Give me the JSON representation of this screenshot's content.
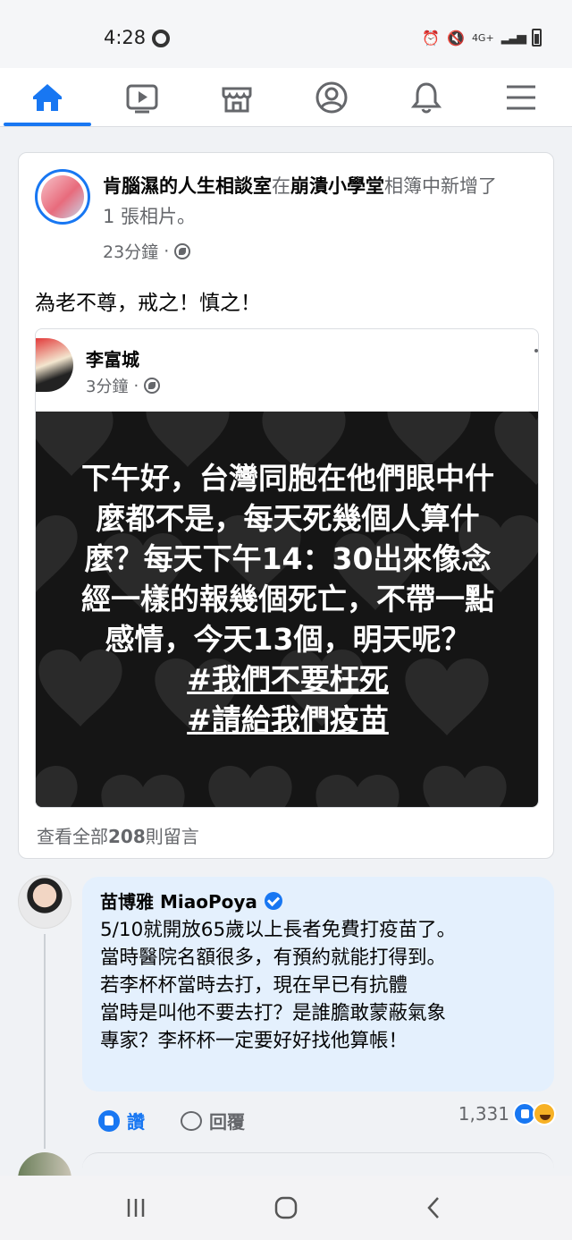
{
  "status_bar": {
    "time": "4:28",
    "network": "4G+",
    "icons": [
      "chrome-icon",
      "alarm-icon",
      "mute-icon",
      "signal-icon",
      "battery-icon"
    ]
  },
  "nav": {
    "items": [
      {
        "name": "home",
        "icon": "home-icon",
        "active": true
      },
      {
        "name": "watch",
        "icon": "video-icon",
        "active": false
      },
      {
        "name": "marketplace",
        "icon": "store-icon",
        "active": false
      },
      {
        "name": "profile",
        "icon": "profile-icon",
        "active": false
      },
      {
        "name": "notifications",
        "icon": "bell-icon",
        "active": false
      },
      {
        "name": "menu",
        "icon": "hamburger-icon",
        "active": false
      }
    ],
    "accent": "#1877f2"
  },
  "post": {
    "author": "肯腦濕的人生相談室",
    "connector": "在",
    "album": "崩潰小學堂",
    "action": "相簿中新增了",
    "action_line2": "1 張相片。",
    "time": "23分鐘",
    "separator": "·",
    "text": "為老不尊，戒之！慎之！",
    "view_comments_prefix": "查看全部",
    "view_comments_count": "208",
    "view_comments_suffix": "則留言"
  },
  "shared_post": {
    "author": "李富城",
    "time": "3分鐘",
    "separator": "·",
    "image_lines": [
      "下午好，台灣同胞在他們眼中什",
      "麼都不是，每天死幾個人算什",
      "麼？每天下午14：30出來像念",
      "經一樣的報幾個死亡，不帶一點",
      "感情，今天13個，明天呢？"
    ],
    "hashtags": [
      "#我們不要枉死",
      "#請給我們疫苗"
    ]
  },
  "comment": {
    "author": "苗博雅 MiaoPoya",
    "verified": true,
    "lines": [
      "5/10就開放65歲以上長者免費打疫苗了。",
      "當時醫院名額很多，有預約就能打得到。",
      "若李杯杯當時去打，現在早已有抗體",
      "當時是叫他不要去打？是誰膽敢蒙蔽氣象",
      "專家？李杯杯一定要好好找他算帳！"
    ],
    "like_label": "讚",
    "reply_label": "回覆",
    "reaction_count": "1,331",
    "reaction_icons": [
      "like-reaction-icon",
      "haha-reaction-icon"
    ]
  },
  "system_nav": {
    "icons": [
      "recents-icon",
      "home-circle-icon",
      "back-icon"
    ]
  }
}
